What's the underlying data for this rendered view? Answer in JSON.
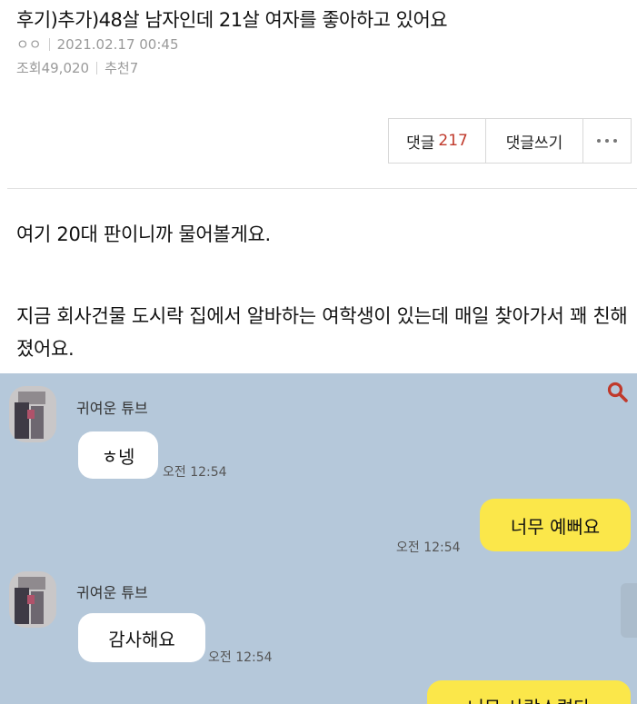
{
  "post": {
    "title": "후기)추가)48살 남자인데 21살 여자를 좋아하고 있어요",
    "author": "ㅇㅇ",
    "date": "2021.02.17 00:45",
    "views_label": "조회49,020",
    "recommend_label": "추천7",
    "comment_label": "댓글",
    "comment_count": "217",
    "write_comment_label": "댓글쓰기",
    "more_icon": "more-dots-icon",
    "body": [
      "여기 20대 판이니까 물어볼게요.",
      "지금 회사건물 도시락 집에서 알바하는 여학생이 있는데 매일 찾아가서 꽤 친해졌어요."
    ]
  },
  "chat": {
    "background": "#b5c8da",
    "search_icon": "search-icon",
    "messages": [
      {
        "sender": "귀여운 튜브",
        "text": "ㅎ넹",
        "time": "오전 12:54",
        "side": "left"
      },
      {
        "sender": "",
        "text": "너무 예뻐요",
        "time": "오전 12:54",
        "side": "right"
      },
      {
        "sender": "귀여운 튜브",
        "text": "감사해요",
        "time": "오전 12:54",
        "side": "left"
      },
      {
        "sender": "",
        "text": "너무 사랑스럽다",
        "time": "",
        "side": "right"
      }
    ]
  },
  "colors": {
    "count": "#c0392b",
    "bubble_yellow": "#fbe74a",
    "bubble_white": "#ffffff"
  }
}
